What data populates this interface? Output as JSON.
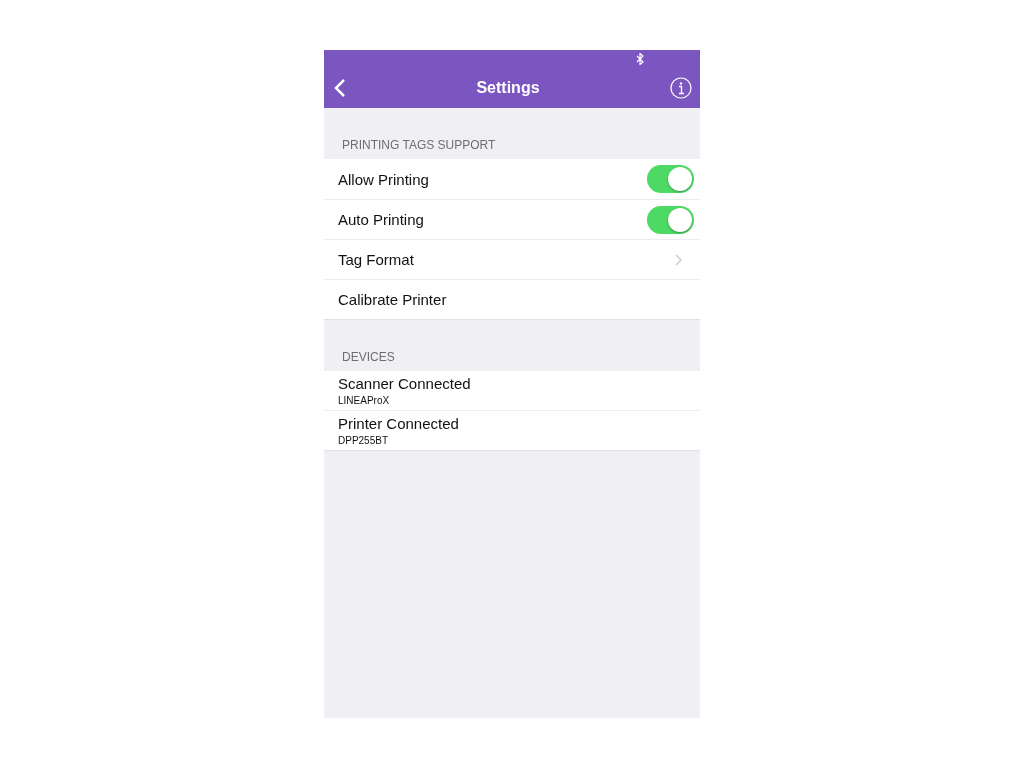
{
  "nav": {
    "title": "Settings"
  },
  "sections": [
    {
      "header": "PRINTING TAGS SUPPORT",
      "rows": [
        {
          "kind": "toggle",
          "label": "Allow Printing",
          "on": true
        },
        {
          "kind": "toggle",
          "label": "Auto Printing",
          "on": true
        },
        {
          "kind": "disclosure",
          "label": "Tag Format"
        },
        {
          "kind": "plain",
          "label": "Calibrate Printer"
        }
      ]
    },
    {
      "header": "DEVICES",
      "rows": [
        {
          "kind": "device",
          "label": "Scanner Connected",
          "detail": "LINEAProX"
        },
        {
          "kind": "device",
          "label": "Printer Connected",
          "detail": "DPP255BT"
        }
      ]
    }
  ]
}
